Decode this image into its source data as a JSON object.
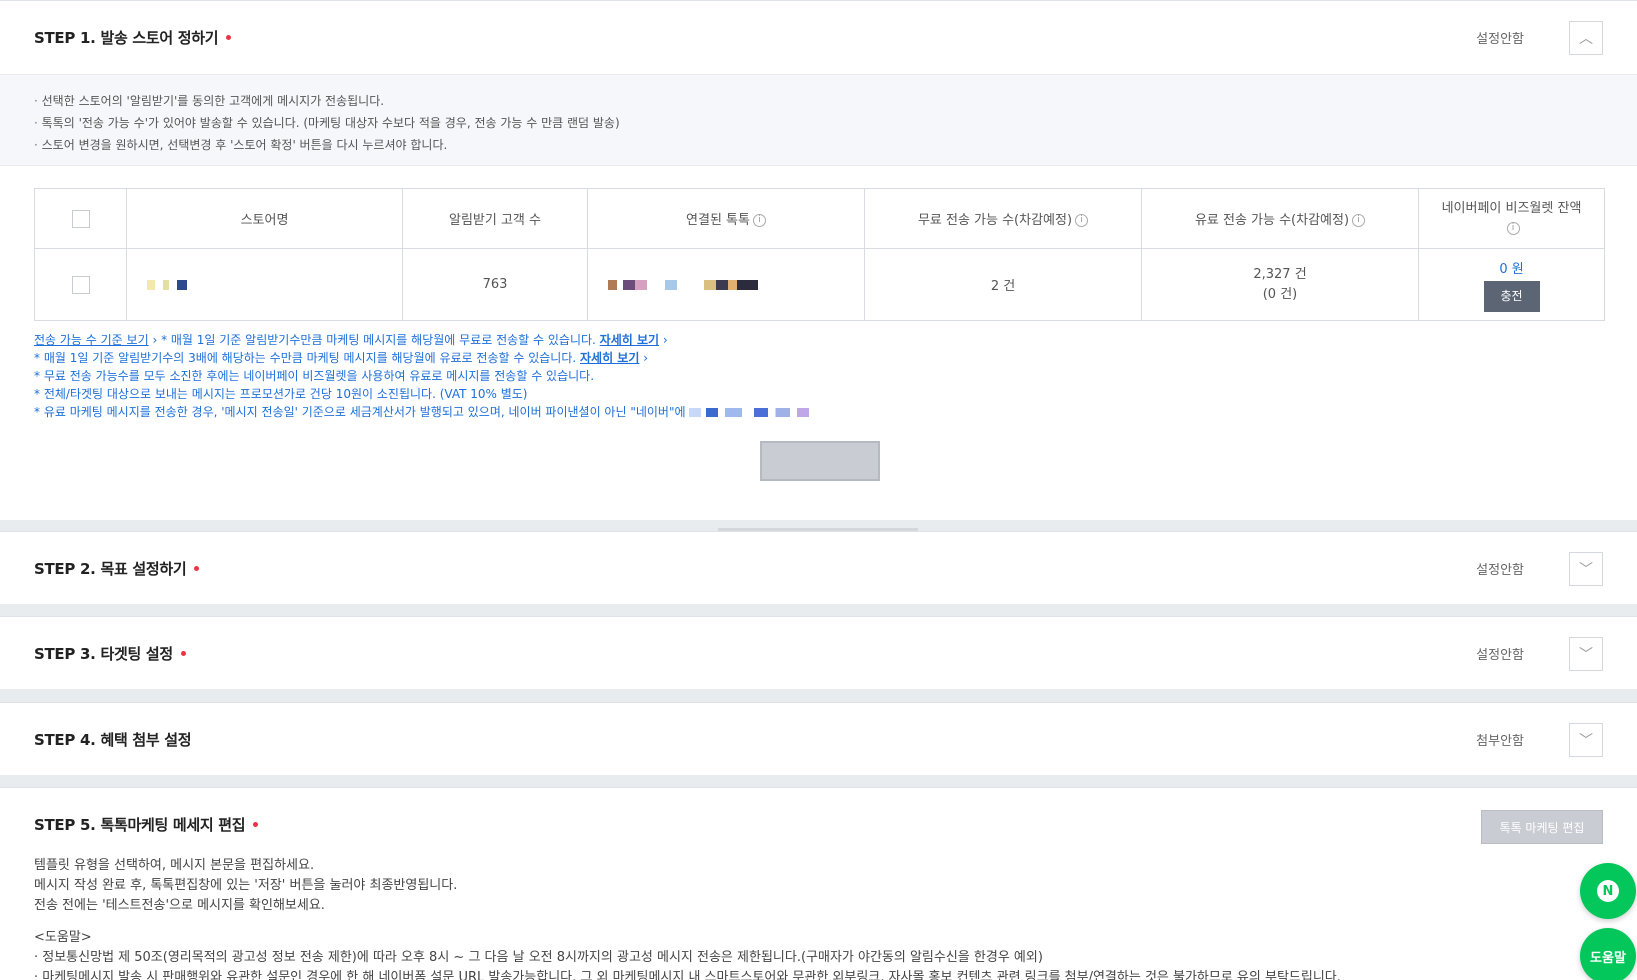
{
  "step1": {
    "title": "STEP 1. 발송 스토어 정하기",
    "status": "설정안함",
    "notices": [
      "선택한 스토어의 '알림받기'를 동의한 고객에게 메시지가 전송됩니다.",
      "톡톡의 '전송 가능 수'가 있어야 발송할 수 있습니다. (마케팅 대상자 수보다 적을 경우, 전송 가능 수 만큼 랜덤 발송)",
      "스토어 변경을 원하시면, 선택변경 후 '스토어 확정' 버튼을 다시 누르셔야 합니다."
    ],
    "table": {
      "headers": {
        "store": "스토어명",
        "subscribers": "알림받기 고객 수",
        "talktalk": "연결된 톡톡",
        "free": "무료 전송 가능 수(차감예정)",
        "paid": "유료 전송 가능 수(차감예정)",
        "wallet": "네이버페이 비즈월렛 잔액"
      },
      "row": {
        "subscribers": "763",
        "free": "2 건",
        "paid": "2,327 건",
        "paid_sub": "(0 건)",
        "wallet": "0 원",
        "charge": "충전"
      }
    },
    "notes": {
      "criteria_link": "전송 가능 수 기준 보기",
      "line1": "* 매월 1일 기준 알림받기수만큼 마케팅 메시지를 해당월에 무료로 전송할 수 있습니다.",
      "line1_link": "자세히 보기",
      "line2": "* 매월 1일 기준 알림받기수의 3배에 해당하는 수만큼 마케팅 메시지를 해당월에 유료로 전송할 수 있습니다.",
      "line2_link": "자세히 보기",
      "line3": "* 무료 전송 가능수를 모두 소진한 후에는 네이버페이 비즈월렛을 사용하여 유료로 메시지를 전송할 수 있습니다.",
      "line4": "* 전체/타겟팅 대상으로 보내는 메시지는 프로모션가로 건당 10원이 소진됩니다. (VAT 10% 별도)",
      "line5": "* 유료 마케팅 메시지를 전송한 경우, '메시지 전송일' 기준으로 세금계산서가 발행되고 있으며, 네이버 파이낸셜이 아닌 \"네이버\"에"
    }
  },
  "step2": {
    "title": "STEP 2. 목표 설정하기",
    "status": "설정안함"
  },
  "step3": {
    "title": "STEP 3. 타겟팅 설정",
    "status": "설정안함"
  },
  "step4": {
    "title": "STEP 4. 혜택 첨부 설정",
    "status": "첨부안함"
  },
  "step5": {
    "title": "STEP 5. 톡톡마케팅 메세지 편집",
    "edit_button": "톡톡 마케팅 편집",
    "desc": [
      "템플릿 유형을 선택하여, 메시지 본문을 편집하세요.",
      "메시지 작성 완료 후, 톡톡편집창에 있는 '저장' 버튼을 눌러야 최종반영됩니다.",
      "전송 전에는 '테스트전송'으로 메시지를 확인해보세요."
    ],
    "help_title": "<도움말>",
    "help": [
      "정보통신망법 제 50조(영리목적의 광고성 정보 전송 제한)에 따라 오후 8시 ~ 그 다음 날 오전 8시까지의 광고성 메시지 전송은 제한됩니다.(구매자가 야간동의 알림수신을 한경우 예외)",
      "마케팅메시지 발송 시 판매행위와 유관한 설문인 경우에 한 해 네이버폼 설문 URL 발송가능합니다. 그 외 마케팅메시지 내 스마트스토어와 무관한 외부링크, 자사몰 홍보 컨텐츠 관련 링크를 첨부/연결하는 것은 불가하므로 유의 부탁드립니다."
    ]
  },
  "fab": {
    "naver": "N",
    "help": "도움말"
  },
  "colors": {
    "accent": "#1e6fd9",
    "required": "#ee3344",
    "naver_green": "#03c75a"
  }
}
